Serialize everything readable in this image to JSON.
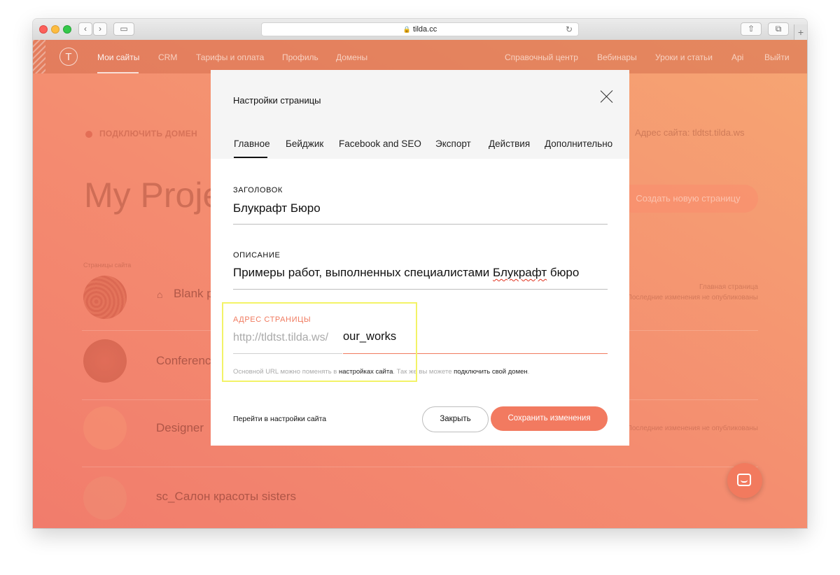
{
  "browser": {
    "url": "tilda.cc"
  },
  "nav": {
    "left": [
      "Мои сайты",
      "CRM",
      "Тарифы и оплата",
      "Профиль",
      "Домены"
    ],
    "right": [
      "Справочный центр",
      "Вебинары",
      "Уроки и статьи",
      "Api",
      "Выйти"
    ]
  },
  "background": {
    "connect_domain": "ПОДКЛЮЧИТЬ ДОМЕН",
    "site_address": "Адрес сайта: tldtst.tilda.ws",
    "title": "My Proje",
    "new_page_button": "Создать новую страницу",
    "section_label": "Страницы сайта",
    "projects": [
      {
        "name": "Blank p",
        "meta_line1": "Главная страница",
        "meta_line2": "Последние изменения не опубликованы"
      },
      {
        "name": "Conferenc",
        "meta_line1": "",
        "meta_line2": ""
      },
      {
        "name": "Designer",
        "meta_line1": "",
        "meta_line2": "Последние изменения не опубликованы"
      },
      {
        "name": "sc_Салон красоты sisters",
        "meta_line1": "",
        "meta_line2": ""
      }
    ]
  },
  "modal": {
    "title": "Настройки страницы",
    "tabs": [
      "Главное",
      "Бейджик",
      "Facebook and SEO",
      "Экспорт",
      "Действия",
      "Дополнительно"
    ],
    "active_tab": "Главное",
    "fields": {
      "title_label": "ЗАГОЛОВОК",
      "title_value": "Блукрафт Бюро",
      "description_label": "ОПИСАНИЕ",
      "description_value_before": "Примеры работ, выполненных специалистами ",
      "description_value_misspelled": "Блукрафт",
      "description_value_after": " бюро",
      "address_label": "АДРЕС СТРАНИЦЫ",
      "address_prefix": "http://tldtst.tilda.ws/",
      "address_value": "our_works"
    },
    "hint": {
      "part1": "Основной URL можно поменять в ",
      "link1": "настройках сайта",
      "part2": ". Так же вы можете ",
      "link2": "подключить свой домен",
      "part3": "."
    },
    "footer": {
      "site_settings_link": "Перейти в настройки сайта",
      "close_button": "Закрыть",
      "save_button": "Сохранить изменения"
    }
  },
  "colors": {
    "accent": "#f27a60",
    "highlight": "#f3f367"
  }
}
